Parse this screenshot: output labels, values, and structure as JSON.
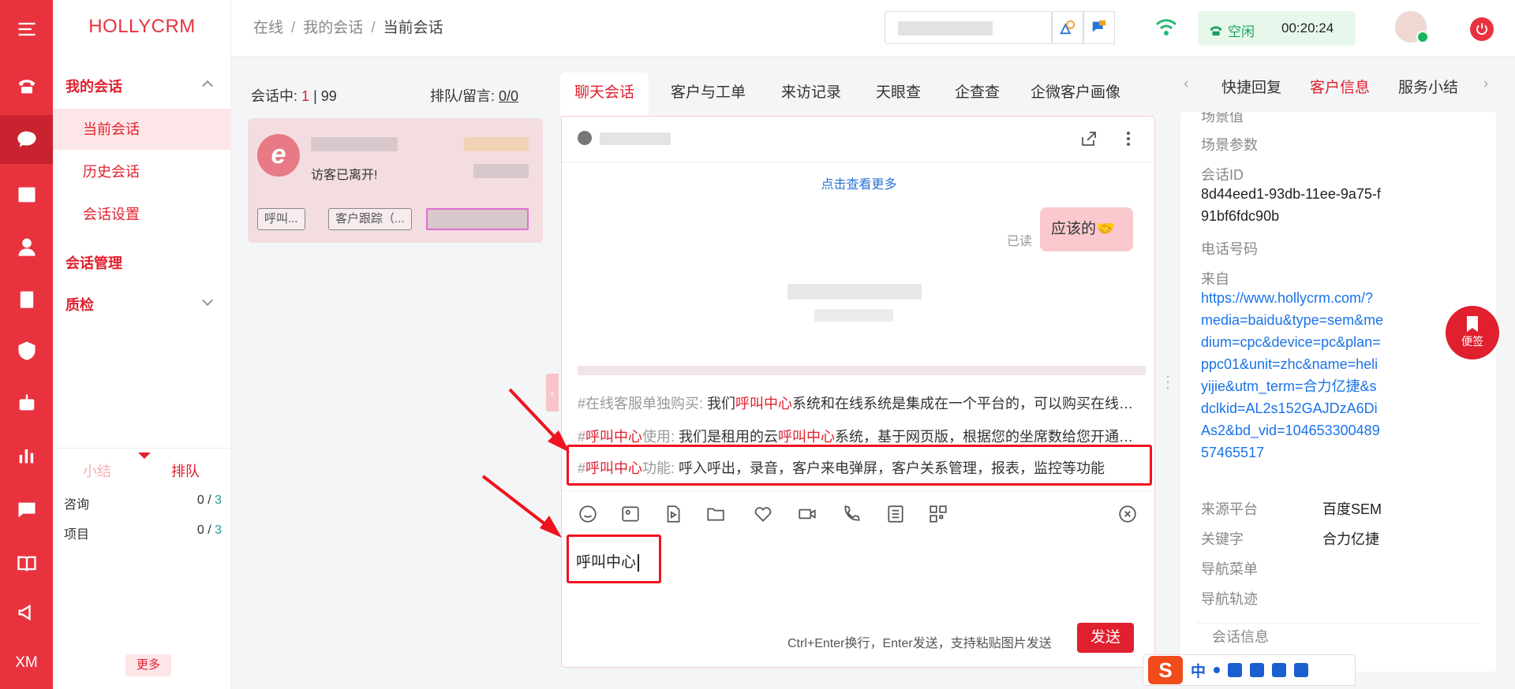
{
  "brand": "HOLLYCRM",
  "rail": {
    "items": [
      "phone-icon",
      "chat-icon",
      "grid-icon",
      "user-icon",
      "clipboard-icon",
      "shield-icon",
      "robot-icon",
      "chart-icon",
      "message-icon",
      "book-icon",
      "megaphone-icon"
    ],
    "xm_label": "XM"
  },
  "nav": {
    "group_my_sessions": "我的会话",
    "item_current": "当前会话",
    "item_history": "历史会话",
    "item_settings": "会话设置",
    "group_manage": "会话管理",
    "group_qc": "质检",
    "tab_summary": "小结",
    "tab_queue": "排队",
    "rows": [
      {
        "label": "咨询",
        "done": "0 / ",
        "total": "3"
      },
      {
        "label": "项目",
        "done": "0 / ",
        "total": "3"
      }
    ],
    "more": "更多"
  },
  "breadcrumb": {
    "items": [
      "在线",
      "我的会话",
      "当前会话"
    ],
    "sep": "/"
  },
  "header": {
    "status_label": "空闲",
    "timer": "00:20:24"
  },
  "session_list": {
    "in_session_label": "会话中:",
    "in_session_count": "1",
    "in_session_max": "| 99",
    "queue_label": "排队/留言:",
    "queue_value": "0/0",
    "card": {
      "message": "访客已离开!",
      "tags": [
        "呼叫...",
        "客户跟踪（..."
      ]
    }
  },
  "chat": {
    "tabs": [
      "聊天会话",
      "客户与工单",
      "来访记录",
      "天眼查",
      "企查查",
      "企微客户画像"
    ],
    "load_more": "点击查看更多",
    "read_label": "已读",
    "bubble_text": "应该的🤝",
    "quick_replies": [
      {
        "key_pre": "#在线客服单独购买:",
        "text_parts": [
          "我们",
          "呼叫中心",
          "系统和在线系统是集成在一个平台的，可以购买在线系统"
        ]
      },
      {
        "key_pre": "#",
        "key_red": "呼叫中心",
        "key_post": "使用:",
        "text_parts": [
          "我们是租用的云",
          "呼叫中心",
          "系统，基于网页版，根据您的坐席数给您开通账号"
        ]
      },
      {
        "key_pre": "#",
        "key_red": "呼叫中心",
        "key_post": "功能:",
        "text_parts": [
          "呼入呼出，录音，客户来电弹屏，客户关系管理，报表，监控等功能",
          "",
          ""
        ]
      }
    ],
    "input_text": "呼叫中心",
    "hint": "Ctrl+Enter换行，Enter发送，支持粘贴图片发送",
    "send": "发送",
    "toolbar_icons": [
      "emoji-icon",
      "image-icon",
      "video-file-icon",
      "folder-icon",
      "heart-icon",
      "video-call-icon",
      "phone-call-icon",
      "notes-icon",
      "qrcode-icon",
      "close-circle-icon"
    ]
  },
  "right": {
    "tabs": [
      "快捷回复",
      "客户信息",
      "服务小结"
    ],
    "fields": {
      "scene_value_label": "场景值",
      "scene_params_label": "场景参数",
      "session_id_label": "会话ID",
      "session_id": "8d44eed1-93db-11ee-9a75-f91bf6fdc90b",
      "phone_label": "电话号码",
      "from_label": "来自",
      "from_url": "https://www.hollycrm.com/?media=baidu&type=sem&medium=cpc&device=pc&plan=ppc01&unit=zhc&name=heliyijie&utm_term=合力亿捷&sdclkid=AL2s152GAJDzA6DiAs2&bd_vid=10465330048957465517",
      "source_platform_label": "来源平台",
      "source_platform": "百度SEM",
      "keyword_label": "关键字",
      "keyword": "合力亿捷",
      "nav_menu_label": "导航菜单",
      "nav_trace_label": "导航轨迹",
      "session_info_label": "会话信息"
    },
    "bookmark_label": "便签"
  },
  "ime": {
    "logo": "S",
    "mode": "中"
  },
  "colors": {
    "brand_red": "#e8333f",
    "accent_red": "#e0202e",
    "link_blue": "#1a73e8",
    "idle_green": "#18a05e"
  }
}
